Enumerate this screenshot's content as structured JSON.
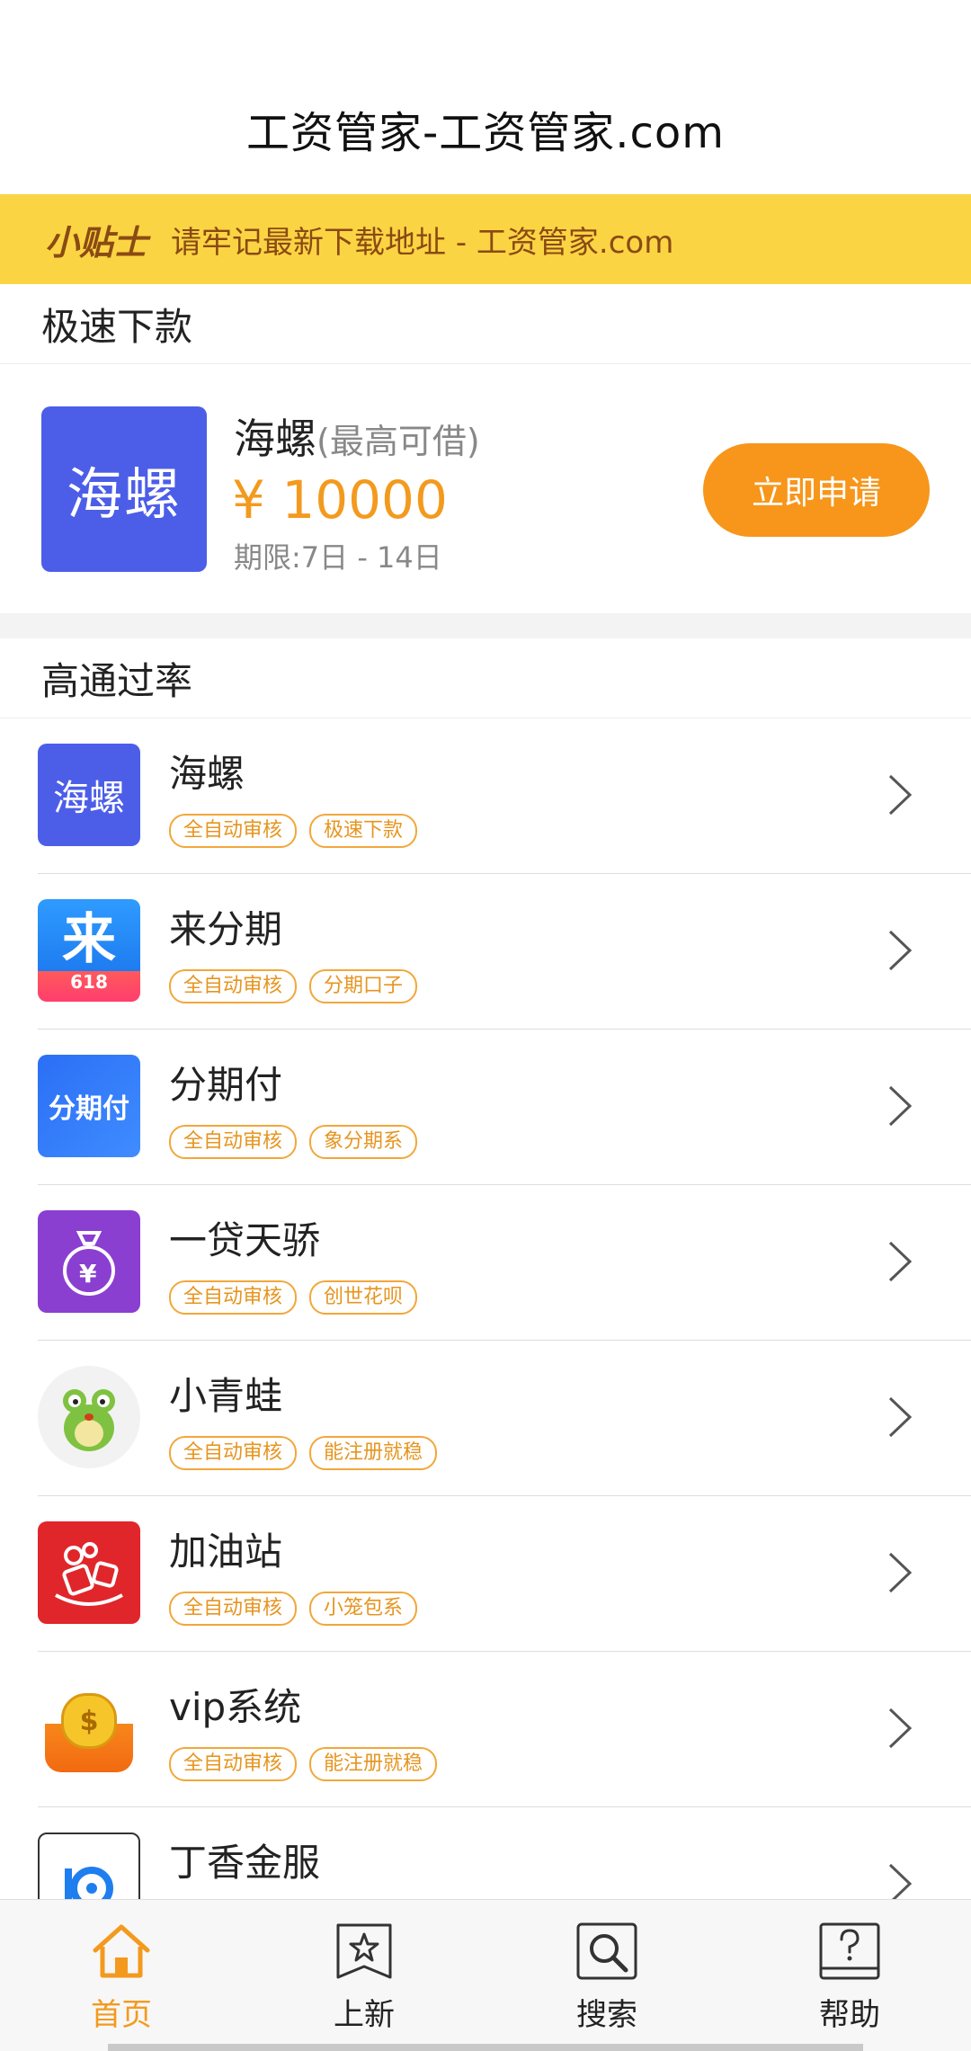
{
  "header": {
    "title": "工资管家-工资管家.com"
  },
  "tip": {
    "badge": "小贴士",
    "text": "请牢记最新下载地址 - 工资管家.com"
  },
  "featured_section": {
    "title": "极速下款",
    "item": {
      "logo_text": "海螺",
      "name": "海螺",
      "sub": "(最高可借)",
      "amount": "¥ 10000",
      "term": "期限:7日 - 14日",
      "button": "立即申请"
    }
  },
  "list_section": {
    "title": "高通过率",
    "items": [
      {
        "name": "海螺",
        "icon": "hailuo-app-icon",
        "icon_text": "海螺",
        "tags": [
          "全自动审核",
          "极速下款"
        ]
      },
      {
        "name": "来分期",
        "icon": "laifenqi-app-icon",
        "icon_text": "来",
        "icon_sub": "618",
        "tags": [
          "全自动审核",
          "分期口子"
        ]
      },
      {
        "name": "分期付",
        "icon": "fenqifu-app-icon",
        "icon_text": "分期付",
        "tags": [
          "全自动审核",
          "象分期系"
        ]
      },
      {
        "name": "一贷天骄",
        "icon": "money-bag-icon",
        "icon_text": "¥",
        "tags": [
          "全自动审核",
          "创世花呗"
        ]
      },
      {
        "name": "小青蛙",
        "icon": "frog-icon",
        "tags": [
          "全自动审核",
          "能注册就稳"
        ]
      },
      {
        "name": "加油站",
        "icon": "gas-station-app-icon",
        "tags": [
          "全自动审核",
          "小笼包系"
        ]
      },
      {
        "name": "vip系统",
        "icon": "gold-coin-icon",
        "icon_text": "$",
        "tags": [
          "全自动审核",
          "能注册就稳"
        ]
      },
      {
        "name": "丁香金服",
        "icon": "dingxiang-app-icon",
        "tags": []
      }
    ]
  },
  "tabbar": {
    "tabs": [
      {
        "label": "首页",
        "icon": "home-icon",
        "active": true
      },
      {
        "label": "上新",
        "icon": "star-bookmark-icon",
        "active": false
      },
      {
        "label": "搜索",
        "icon": "search-icon",
        "active": false
      },
      {
        "label": "帮助",
        "icon": "help-icon",
        "active": false
      }
    ]
  },
  "colors": {
    "accent": "#f7961a",
    "tip_bg": "#fbd443",
    "tip_text": "#8a4a14",
    "brand_blue": "#4c5ee8"
  }
}
